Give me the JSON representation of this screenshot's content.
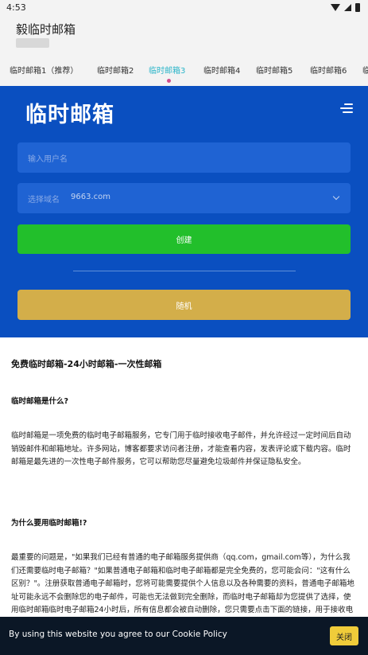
{
  "status_bar": {
    "time": "4:53",
    "icons": [
      "wifi-icon",
      "signal-icon",
      "battery-icon"
    ]
  },
  "app_header": {
    "title": "毅临时邮箱"
  },
  "tabs": [
    {
      "label": "临时邮箱1（推荐）"
    },
    {
      "label": "临时邮箱2"
    },
    {
      "label": "临时邮箱3",
      "active": true
    },
    {
      "label": "临时邮箱4"
    },
    {
      "label": "临时邮箱5"
    },
    {
      "label": "临时邮箱6"
    },
    {
      "label": "临"
    }
  ],
  "hero": {
    "logo_text": "临时邮箱",
    "username_placeholder": "输入用户名",
    "domain_label": "选择域名",
    "domain_value": "9663.com",
    "create_label": "创建",
    "random_label": "随机",
    "colors": {
      "background": "#0a4fc0",
      "create": "#22bf2b",
      "random": "#d3ae4a"
    }
  },
  "content": {
    "title": "免费临时邮箱-24小时邮箱-一次性邮箱",
    "section1_heading": "临时邮箱是什么?",
    "section1_body": "临时邮箱是一项免费的临时电子邮箱服务，它专门用于临时接收电子邮件，并允许经过一定时间后自动销毁邮件和邮箱地址。许多网站，博客都要求访问者注册，才能查看内容，发表评论或下载内容。临时邮箱是最先进的一次性电子邮件服务，它可以帮助您尽量避免垃圾邮件并保证隐私安全。",
    "section2_heading": "为什么要用临时邮箱!?",
    "section2_body": "最重要的问题是，\"如果我们已经有普通的电子邮箱服务提供商（qq.com，gmail.com等），为什么我们还需要临时电子邮箱？\"如果普通电子邮箱和临时电子邮箱都是完全免费的，您可能会问：\"这有什么区别？\"。注册获取普通电子邮箱时，您将可能需要提供个人信息以及各种需要的资料，普通电子邮箱地址可能永远不会删除您的电子邮件，可能也无法做到完全删除，而临时电子邮箱却为您提供了选择，使用临时邮箱临时电子邮箱24小时后，所有信息都会被自动删除，您只需要点击下面的链接，用于接收电子邮件即可。"
  },
  "cookie_bar": {
    "text": "By using this website you agree to our Cookie Policy",
    "close_label": "关闭"
  }
}
